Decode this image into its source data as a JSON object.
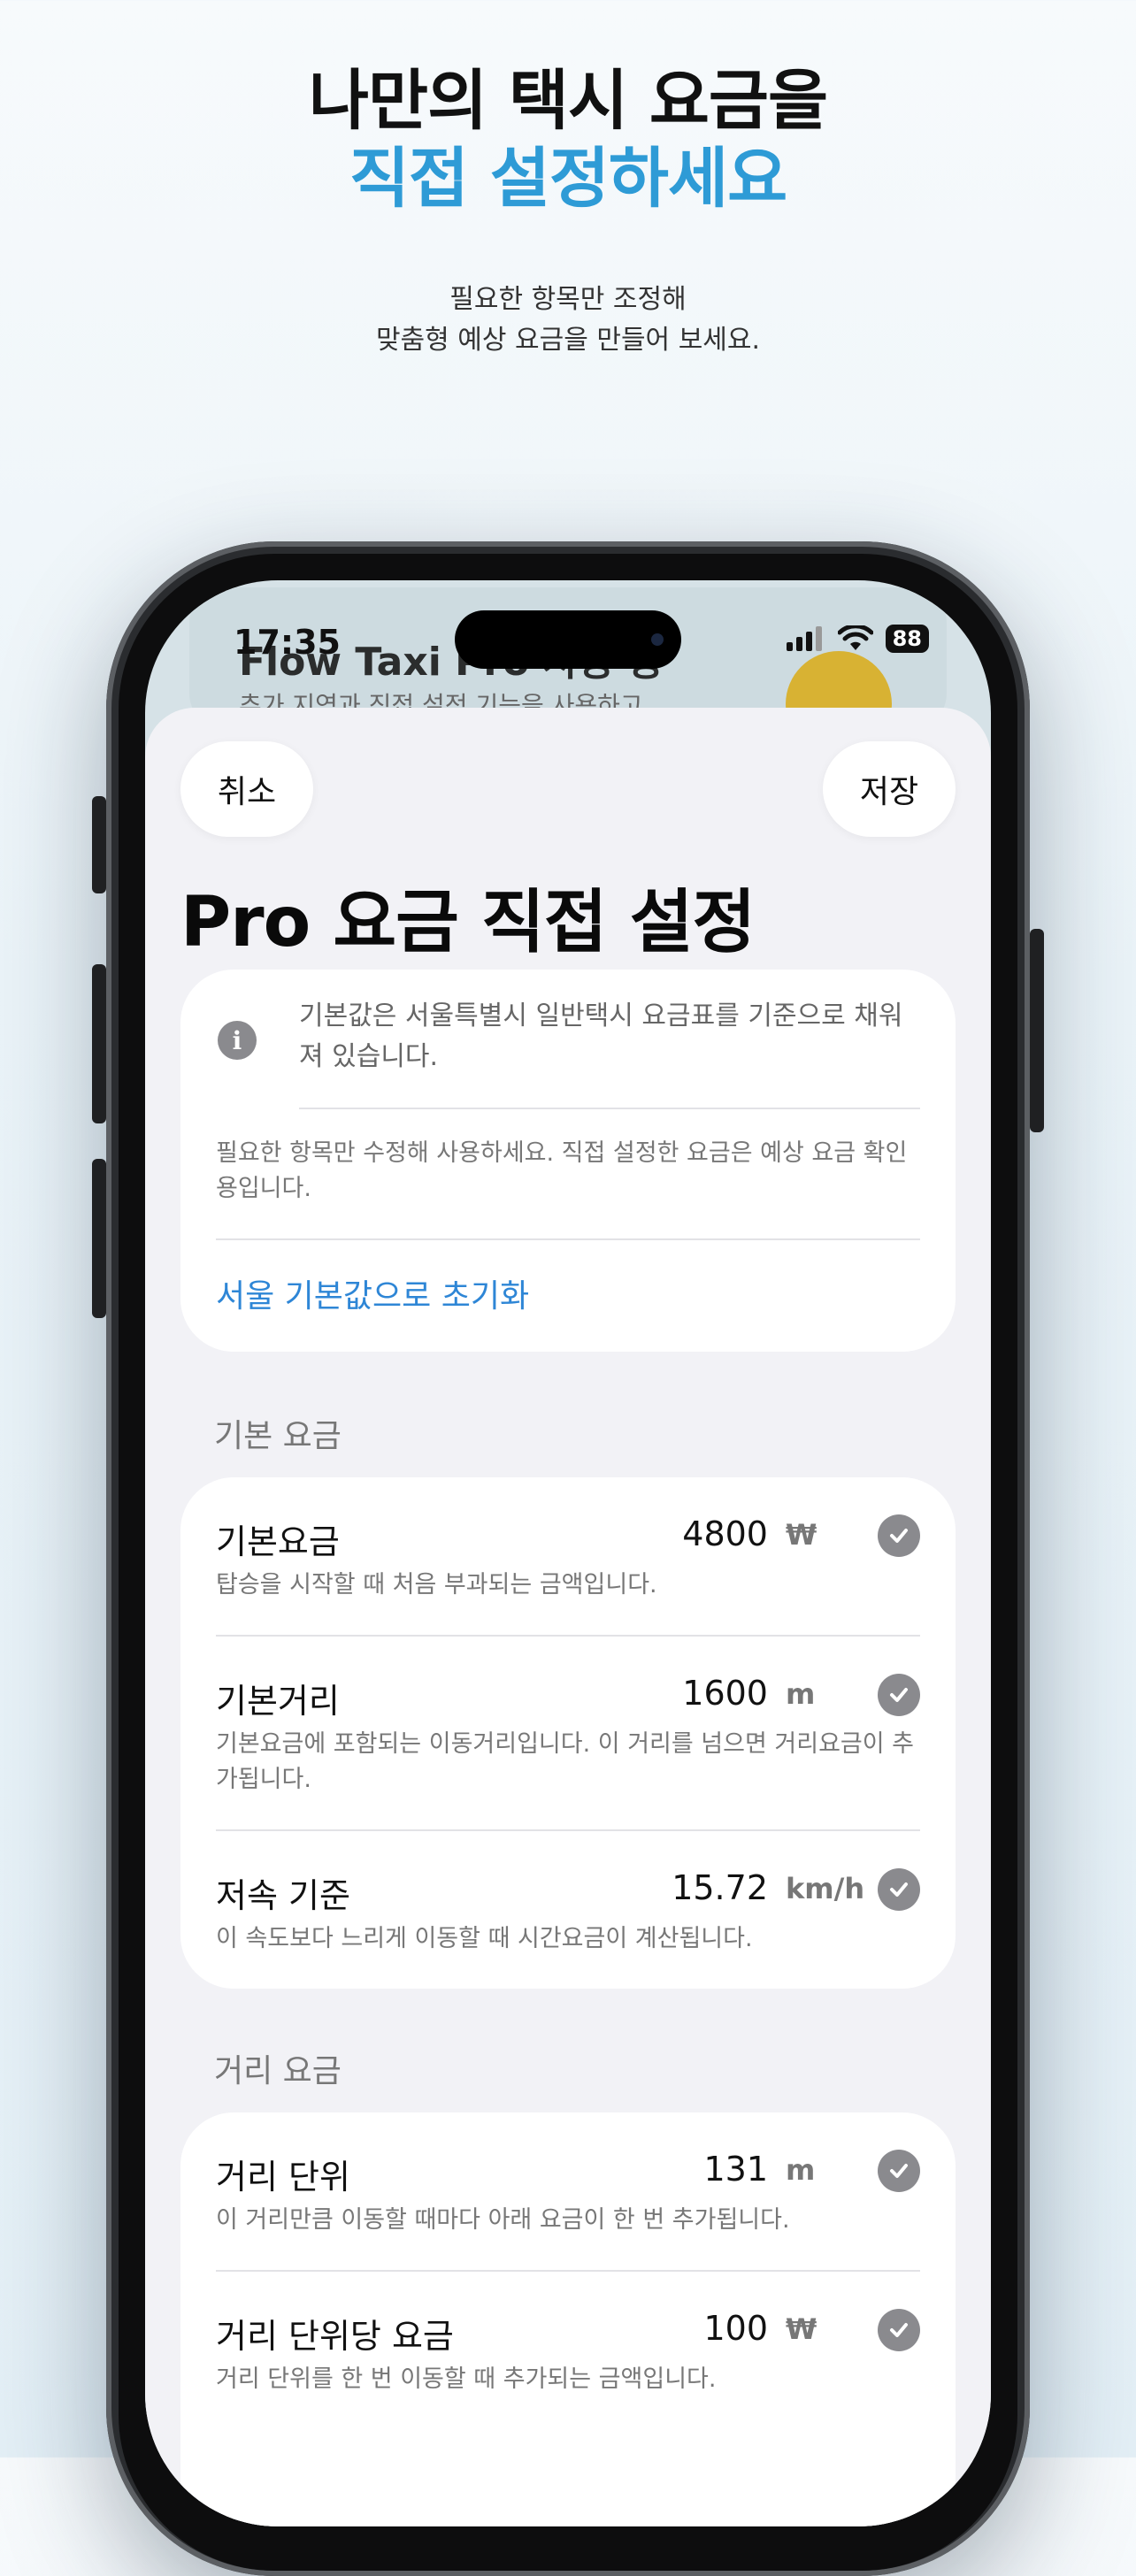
{
  "hero": {
    "title_line1": "나만의 택시 요금을",
    "title_line2": "직접 설정하세요",
    "subtitle_line1": "필요한 항목만 조정해",
    "subtitle_line2": "맞춤형 예상 요금을 만들어 보세요."
  },
  "status_bar": {
    "time": "17:35",
    "battery": "88"
  },
  "background_app": {
    "title": "Flow Taxi Pro 사용 중",
    "desc": "추가 지역과 직접 설정 기능을 사용하고"
  },
  "sheet": {
    "cancel_label": "취소",
    "save_label": "저장",
    "title": "Pro 요금 직접 설정"
  },
  "info_card": {
    "icon": "info-icon",
    "message": "기본값은 서울특별시 일반택시 요금표를 기준으로 채워져 있습니다.",
    "note": "필요한 항목만 수정해 사용하세요. 직접 설정한 요금은 예상 요금 확인용입니다.",
    "reset_link": "서울 기본값으로 초기화"
  },
  "sections": {
    "base": {
      "label": "기본 요금",
      "rows": [
        {
          "label": "기본요금",
          "value": "4800",
          "unit": "₩",
          "desc": "탑승을 시작할 때 처음 부과되는 금액입니다."
        },
        {
          "label": "기본거리",
          "value": "1600",
          "unit": "m",
          "desc": "기본요금에 포함되는 이동거리입니다. 이 거리를 넘으면 거리요금이 추가됩니다."
        },
        {
          "label": "저속 기준",
          "value": "15.72",
          "unit": "km/h",
          "desc": "이 속도보다 느리게 이동할 때 시간요금이 계산됩니다."
        }
      ]
    },
    "distance": {
      "label": "거리 요금",
      "rows": [
        {
          "label": "거리 단위",
          "value": "131",
          "unit": "m",
          "desc": "이 거리만큼 이동할 때마다 아래 요금이 한 번 추가됩니다."
        },
        {
          "label": "거리 단위당 요금",
          "value": "100",
          "unit": "₩",
          "desc": "거리 단위를 한 번 이동할 때 추가되는 금액입니다."
        }
      ]
    }
  },
  "colors": {
    "accent_blue": "#2e9bd6",
    "link_blue": "#2e86d6",
    "check_gray": "#8a8a8e"
  }
}
